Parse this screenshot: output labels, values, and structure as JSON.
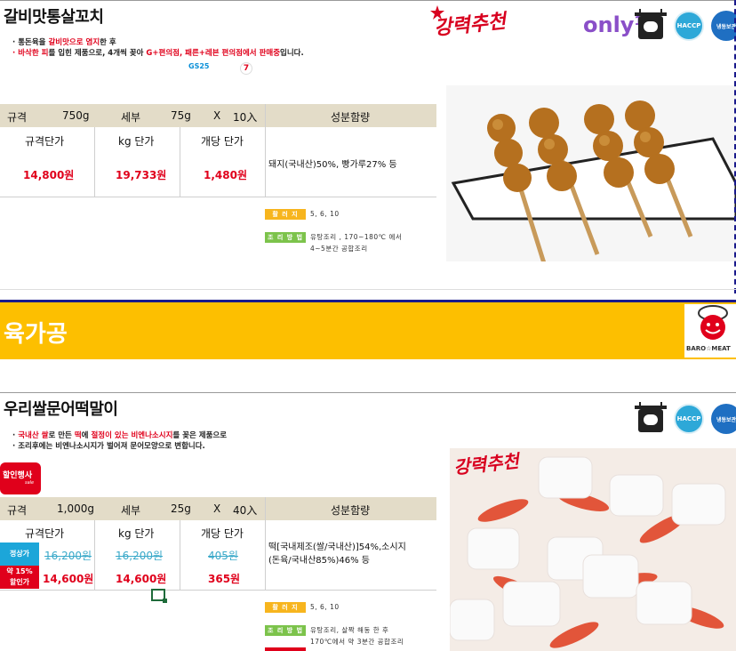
{
  "product1": {
    "title": "갈비맛통살꼬치",
    "desc_line1": {
      "prefix": "· 통돈육을 ",
      "red": "갈비맛으로 염지",
      "suffix": "한 후"
    },
    "desc_line2": {
      "red1": "· 바삭한 피",
      "mid1": "를 입힌 제품으로, 4개씩 꽂아 ",
      "red2": "G+편의점, 패른+레븐 편의점에서 판매중",
      "suffix": "입니다."
    },
    "store_gs": "GS25",
    "store_711": "7",
    "brand_script": "강력추천",
    "only_mark": "only¹",
    "haccp": "HACCP",
    "storage": "냉동보관",
    "header": {
      "spec_label": "규격",
      "spec_value": "750g",
      "detail_label": "세부",
      "detail_value": "75g",
      "x": "X",
      "count": "10入",
      "ingredients_label": "성분함량"
    },
    "cols": {
      "unit_price": "규격단가",
      "kg_price": "kg 단가",
      "each_price": "개당 단가"
    },
    "prices": {
      "unit": "14,800원",
      "kg": "19,733원",
      "each": "1,480원"
    },
    "ingredients": "돼지(국내산)50%, 빵가루27% 등",
    "tag_cooking_label": "활 러 지",
    "tag_cooking_value": "5, 6, 10",
    "tag_method_label": "조 리 방 법",
    "tag_method_line1": "유탕조리 , 170~180℃ 에서",
    "tag_method_line2": "4~5분간 공합조리"
  },
  "section": {
    "title": "육가공",
    "logo_text": "BARO☆MEAT"
  },
  "product2": {
    "title": "우리쌀문어떡말이",
    "desc_line1": {
      "prefix": "· ",
      "red1": "국내산 쌀",
      "mid1": "로 만든 ",
      "red2": "떡",
      "mid2": "에 ",
      "red3": "절정이 있는 비엔나소시지",
      "suffix": "를 꽂은 제품으로"
    },
    "desc_line2": "· 조리후에는 비엔나소시지가 벌어져 문어모양으로 변합니다.",
    "sale_badge": "할인행사",
    "sale_sub": "sale",
    "brand_script": "강력추천",
    "haccp": "HACCP",
    "storage": "냉동보관",
    "header": {
      "spec_label": "규격",
      "spec_value": "1,000g",
      "detail_label": "세부",
      "detail_value": "25g",
      "x": "X",
      "count": "40入",
      "ingredients_label": "성분함량"
    },
    "cols": {
      "unit_price": "규격단가",
      "kg_price": "kg 단가",
      "each_price": "개당 단가"
    },
    "regular_label": "정상가",
    "discount_label1": "약 15%",
    "discount_label2": "할인가",
    "regular": {
      "unit": "16,200원",
      "kg": "16,200원",
      "each": "405원"
    },
    "sale": {
      "unit": "14,600원",
      "kg": "14,600원",
      "each": "365원"
    },
    "ingredients_line1": "떡[국내제조(쌀/국내산)]54%,소시지",
    "ingredients_line2": "(돈육/국내산85%)46% 등",
    "tag_cooking_label": "활 러 지",
    "tag_cooking_value": "5, 6, 10",
    "tag_method_label": "조 리 방 법",
    "tag_method_line1": "유탕조리, 살짝 해동 한 후",
    "tag_method_line2": "170℃에서 약 3분간 공합조리"
  },
  "colors": {
    "accent_red": "#e0001b",
    "section_yellow": "#fdbf00",
    "header_beige": "#e3dcc8",
    "navy_rule": "#1a1a8c"
  }
}
